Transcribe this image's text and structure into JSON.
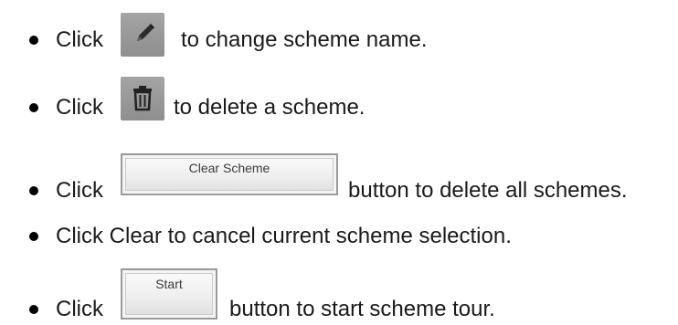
{
  "bullets": [
    {
      "click": "Click",
      "icon": "pencil-icon",
      "text": "to change scheme name."
    },
    {
      "click": "Click",
      "icon": "trash-icon",
      "text": "to delete a scheme."
    },
    {
      "click": "Click",
      "button_label": "Clear Scheme",
      "text": "button to delete all schemes."
    },
    {
      "text": "Click Clear to cancel current scheme selection."
    },
    {
      "click": "Click",
      "button_label": "Start",
      "text": "button to start scheme tour."
    }
  ],
  "colors": {
    "bullet": "#000000",
    "text": "#1a1a1a",
    "icon_bg": "#9a9a9a",
    "icon_glyph": "#2b2b2b"
  }
}
